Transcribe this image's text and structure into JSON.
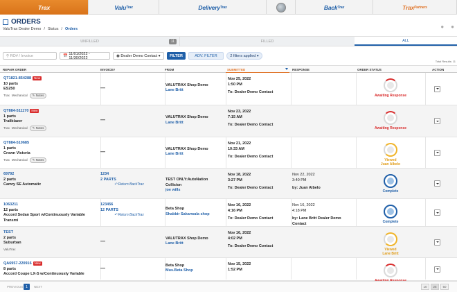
{
  "topnav": {
    "trax": "Trax",
    "valu_a": "Valu",
    "valu_b": "Trax",
    "delivery_a": "Delivery",
    "delivery_b": "Trax",
    "back_a": "Back",
    "back_b": "Trax",
    "partners_a": "Trax",
    "partners_b": "Partners"
  },
  "header": {
    "title": "ORDERS",
    "breadcrumb": [
      "ValuTrax Dealer Demo",
      "/",
      "Status",
      "/",
      "Orders"
    ]
  },
  "status_tabs": {
    "unfilled": "UNFILLED",
    "unfilled_count": "11",
    "filled": "FILLED",
    "all": "ALL"
  },
  "filters": {
    "search_placeholder": "RO# / Invoice",
    "date_range": "11/01/2022 - 11/30/2022",
    "contact": "Dealer Demo Contact",
    "filter_label": "FILTER",
    "adv_label": "ADV. FILTER",
    "applied_label": "2 filters applied",
    "total": "Total Results: 11"
  },
  "columns": [
    "REPAIR ORDER",
    "INVOICE#",
    "FROM",
    "SUBMITTED",
    "RESPONSE",
    "ORDER STATUS",
    "ACTION"
  ],
  "colors": {
    "accent": "#1f5fa8",
    "brand_orange": "#e0752a",
    "awaiting": "#d92c2c",
    "viewed": "#e09a12"
  },
  "rows": [
    {
      "ro": "QT1821-854288",
      "new": "New",
      "parts": "10 parts",
      "vehicle": "ES250",
      "tag": "Trax",
      "tag2": "Mechanical",
      "notes": "Notes",
      "invoice": "—",
      "from_shop": "VALUTRAX Shop Demo",
      "from_person": "Lane Britt",
      "sub_date": "Nov 25, 2022",
      "sub_time": "1:50 PM",
      "sub_to": "To: Dealer Demo Contact",
      "status": "Awaiting Response"
    },
    {
      "ro": "QT884-511170",
      "new": "New",
      "parts": "1 parts",
      "vehicle": "Trailblazer",
      "tag": "Trax",
      "tag2": "Mechanical",
      "notes": "Notes",
      "invoice": "—",
      "from_shop": "VALUTRAX Shop Demo",
      "from_person": "Lane Britt",
      "sub_date": "Nov 23, 2022",
      "sub_time": "7:15 AM",
      "sub_to": "To: Dealer Demo Contact",
      "status": "Awaiting Response"
    },
    {
      "ro": "QT884-510685",
      "parts": "1 parts",
      "vehicle": "Crown Victoria",
      "tag": "Trax",
      "tag2": "Mechanical",
      "notes": "Notes",
      "invoice": "—",
      "from_shop": "VALUTRAX Shop Demo",
      "from_person": "Lane Britt",
      "sub_date": "Nov 21, 2022",
      "sub_time": "10:33 AM",
      "sub_to": "To: Dealer Demo Contact",
      "status": "Viewed",
      "status_by": "Juan Albelo"
    },
    {
      "ro": "69792",
      "parts": "2 parts",
      "vehicle": "Camry SE Automatic",
      "invoice_no": "1234",
      "invoice_parts": "2 PARTS",
      "return": "Return BackTrax",
      "from_shop": "TEST ONLY:AutoNation Collision",
      "from_person": "joe wills",
      "sub_date": "Nov 18, 2022",
      "sub_time": "3:27 PM",
      "sub_to": "To: Dealer Demo Contact",
      "resp_date": "Nov 22, 2022",
      "resp_time": "3:40 PM",
      "resp_by": "by: Juan Albelo",
      "status": "Complete"
    },
    {
      "ro": "1063211",
      "parts": "12 parts",
      "vehicle": "Accord Sedan Sport w/Continuously Variable Transmi",
      "invoice_no": "123456",
      "invoice_parts": "12 PARTS",
      "return": "Return BackTrax",
      "from_shop": "Beta Shop",
      "from_person": "Shabbir Sakarwala shop",
      "sub_date": "Nov 16, 2022",
      "sub_time": "4:16 PM",
      "sub_to": "To: Dealer Demo Contact",
      "resp_date": "Nov 16, 2022",
      "resp_time": "4:18 PM",
      "resp_by": "by: Lane Britt Dealer Demo Contact",
      "status": "Complete"
    },
    {
      "ro": "TEST",
      "parts": "2 parts",
      "vehicle": "Suburban",
      "tag": "ValuTrax",
      "invoice": "—",
      "from_shop": "VALUTRAX Shop Demo",
      "from_person": "Lane Britt",
      "sub_date": "Nov 16, 2022",
      "sub_time": "4:02 PM",
      "sub_to": "To: Dealer Demo Contact",
      "status": "Viewed",
      "status_by": "Lane Britt"
    },
    {
      "ro": "QA6957-220916",
      "new": "New",
      "parts": "8 parts",
      "vehicle": "Accord Coupe LX-S w/Continuously Variable",
      "invoice": "—",
      "from_shop": "Beta Shop",
      "from_person": "Mus.Beta Shop",
      "sub_date": "Nov 15, 2022",
      "sub_time": "1:52 PM",
      "status": "Awaiting Response"
    }
  ],
  "pager": {
    "prev": "PREVIOUS",
    "page": "1",
    "next": "NEXT",
    "sizes": [
      "10",
      "25",
      "50"
    ]
  }
}
